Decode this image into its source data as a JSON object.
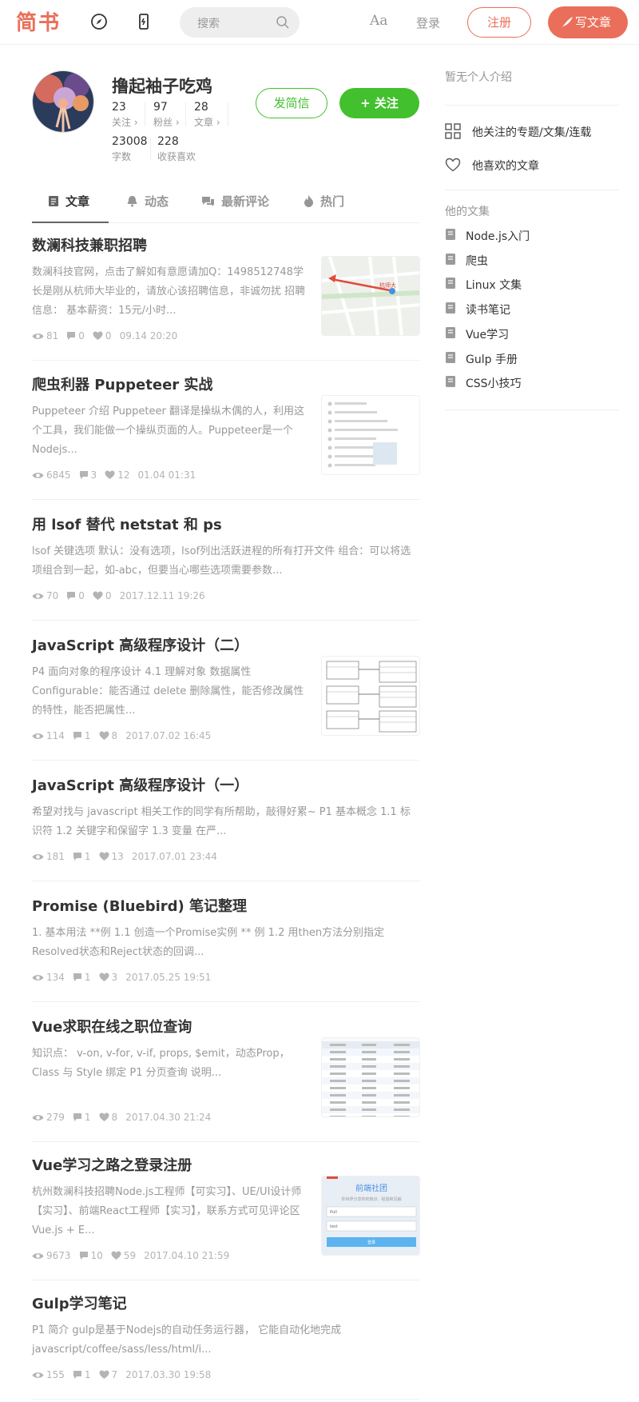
{
  "header": {
    "logo": "简书",
    "search_placeholder": "搜索",
    "font_toggle": "Aa",
    "login": "登录",
    "register": "注册",
    "write": "写文章"
  },
  "profile": {
    "name": "撸起袖子吃鸡",
    "stats": [
      {
        "num": "23",
        "label": "关注 ›"
      },
      {
        "num": "97",
        "label": "粉丝 ›"
      },
      {
        "num": "28",
        "label": "文章 ›"
      },
      {
        "num": "23008",
        "label": "字数"
      },
      {
        "num": "228",
        "label": "收获喜欢"
      }
    ],
    "message_button": "发简信",
    "follow_button": "+ 关注"
  },
  "tabs": [
    {
      "label": "文章",
      "icon": "article-icon",
      "active": true
    },
    {
      "label": "动态",
      "icon": "bell-icon",
      "active": false
    },
    {
      "label": "最新评论",
      "icon": "comments-icon",
      "active": false
    },
    {
      "label": "热门",
      "icon": "fire-icon",
      "active": false
    }
  ],
  "articles": [
    {
      "title": "数澜科技兼职招聘",
      "abstract": "数澜科技官网，点击了解如有意愿请加Q：1498512748学长是刚从杭师大毕业的，请放心该招聘信息，非诚勿扰 招聘信息： 基本薪资：15元/小时...",
      "views": "81",
      "comments": "0",
      "likes": "0",
      "time": "09.14 20:20",
      "thumb": "map"
    },
    {
      "title": "爬虫利器 Puppeteer 实战",
      "abstract": "Puppeteer 介绍 Puppeteer 翻译是操纵木偶的人，利用这个工具，我们能做一个操纵页面的人。Puppeteer是一个Nodejs...",
      "views": "6845",
      "comments": "3",
      "likes": "12",
      "time": "01.04 01:31",
      "thumb": "doc"
    },
    {
      "title": "用 lsof 替代 netstat 和 ps",
      "abstract": "lsof 关键选项 默认：没有选项，lsof列出活跃进程的所有打开文件 组合：可以将选项组合到一起，如-abc，但要当心哪些选项需要参数...",
      "views": "70",
      "comments": "0",
      "likes": "0",
      "time": "2017.12.11 19:26",
      "thumb": ""
    },
    {
      "title": "JavaScript 高级程序设计（二）",
      "abstract": "P4 面向对象的程序设计 4.1 理解对象 数据属性 Configurable：能否通过 delete 删除属性，能否修改属性的特性，能否把属性...",
      "views": "114",
      "comments": "1",
      "likes": "8",
      "time": "2017.07.02 16:45",
      "thumb": "diagram"
    },
    {
      "title": "JavaScript 高级程序设计（一）",
      "abstract": "希望对找与 javascript 相关工作的同学有所帮助，敲得好累~ P1 基本概念 1.1 标识符 1.2 关键字和保留字 1.3 变量 在严...",
      "views": "181",
      "comments": "1",
      "likes": "13",
      "time": "2017.07.01 23:44",
      "thumb": ""
    },
    {
      "title": "Promise (Bluebird) 笔记整理",
      "abstract": "1. 基本用法 **例 1.1 创造一个Promise实例 ** 例 1.2 用then方法分别指定Resolved状态和Reject状态的回调...",
      "views": "134",
      "comments": "1",
      "likes": "3",
      "time": "2017.05.25 19:51",
      "thumb": ""
    },
    {
      "title": "Vue求职在线之职位查询",
      "abstract": "知识点： v-on, v-for, v-if, props, $emit，动态Prop， Class 与 Style 绑定 P1 分页查询 说明...",
      "views": "279",
      "comments": "1",
      "likes": "8",
      "time": "2017.04.30 21:24",
      "thumb": "table"
    },
    {
      "title": "Vue学习之路之登录注册",
      "abstract": "杭州数澜科技招聘Node.js工程师【可实习】、UE/UI设计师【实习】、前端React工程师【实习】，联系方式可见评论区 Vue.js + E...",
      "views": "9673",
      "comments": "10",
      "likes": "59",
      "time": "2017.04.10 21:59",
      "thumb": "login"
    },
    {
      "title": "Gulp学习笔记",
      "abstract": "P1 简介 gulp是基于Nodejs的自动任务运行器， 它能自动化地完成 javascript/coffee/sass/less/html/i...",
      "views": "155",
      "comments": "1",
      "likes": "7",
      "time": "2017.03.30 19:58",
      "thumb": ""
    }
  ],
  "thumb_text": {
    "map_label": "杭师大",
    "login_title": "前端社团",
    "login_sub": "你世界分享你的知识、经验和见解",
    "login_field1": "Pull",
    "login_field2": "test",
    "login_button": "登录"
  },
  "sidebar": {
    "intro": "暂无个人介绍",
    "links": [
      {
        "label": "他关注的专题/文集/连载",
        "icon": "grid-icon"
      },
      {
        "label": "他喜欢的文章",
        "icon": "heart-icon"
      }
    ],
    "collections_title": "他的文集",
    "collections": [
      "Node.js入门",
      "爬虫",
      "Linux 文集",
      "读书笔记",
      "Vue学习",
      "Gulp 手册",
      "CSS小技巧"
    ]
  },
  "colors": {
    "brand": "#ea6f5a",
    "follow_green": "#42c02e",
    "muted": "#969696"
  }
}
